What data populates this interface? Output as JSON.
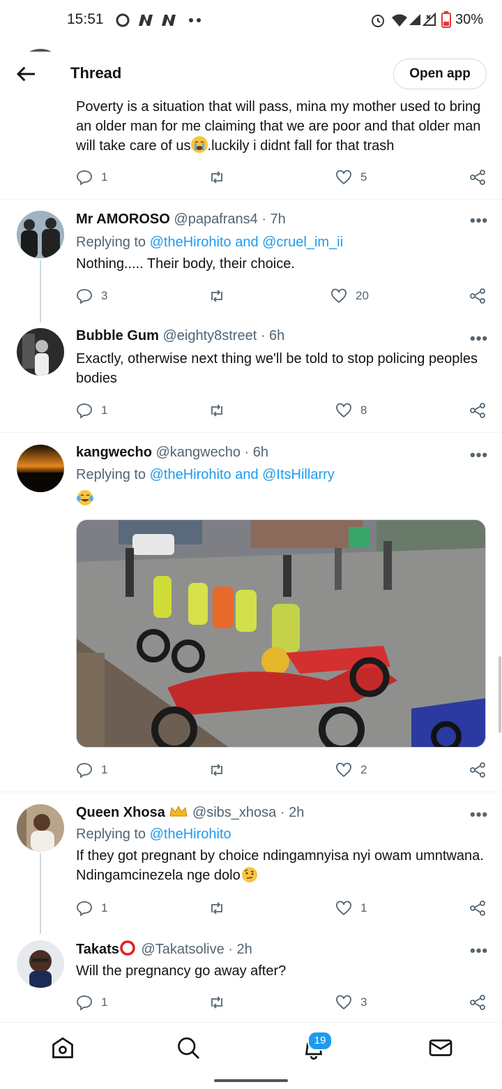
{
  "status": {
    "time": "15:51",
    "battery": "30%",
    "left_icons": [
      "circle-o-icon",
      "n-logo-icon",
      "n-logo-icon",
      "dots-icon"
    ],
    "right_icons": [
      "alarm-icon",
      "wifi-icon",
      "signal-icon",
      "signal-x-icon",
      "battery-icon"
    ]
  },
  "header": {
    "title": "Thread",
    "open_app": "Open app"
  },
  "tweets": [
    {
      "text": "Poverty is a situation that will pass, mina my mother used to bring an older man for me claiming that we are poor and that older man will take care of us",
      "text_tail": ".luckily i didnt fall for that trash",
      "replies": "1",
      "likes": "5"
    },
    {
      "name": "Mr AMOROSO",
      "handle": "@papafrans4 · 7h",
      "replying_prefix": "Replying to ",
      "replying_to": "@theHirohito and @cruel_im_ii",
      "text": "Nothing..... Their body, their choice.",
      "replies": "3",
      "likes": "20"
    },
    {
      "name": "Bubble Gum",
      "handle": "@eighty8street · 6h",
      "text": "Exactly, otherwise next thing we'll be told to stop policing peoples bodies",
      "replies": "1",
      "likes": "8"
    },
    {
      "name": "kangwecho",
      "handle": "@kangwecho · 6h",
      "replying_prefix": "Replying to ",
      "replying_to": "@theHirohito and @ItsHillarry",
      "replies": "1",
      "likes": "2"
    },
    {
      "name": "Queen Xhosa",
      "handle": "@sibs_xhosa · 2h",
      "replying_prefix": "Replying to ",
      "replying_to": "@theHirohito",
      "text": "If they got pregnant by choice ndingamnyisa nyi owam umntwana. Ndingamcinezela nge dolo",
      "replies": "1",
      "likes": "1"
    },
    {
      "name": "Takats",
      "handle": "@Takatsolive · 2h",
      "text": "Will the pregnancy go away after?",
      "replies": "1",
      "likes": "3"
    }
  ],
  "nav": {
    "notification_count": "19",
    "icons": [
      "home-icon",
      "search-icon",
      "notifications-icon",
      "messages-icon"
    ]
  },
  "colors": {
    "link": "#1d9bf0",
    "muted": "#536471",
    "text": "#0f1419",
    "border": "#eff3f4"
  }
}
